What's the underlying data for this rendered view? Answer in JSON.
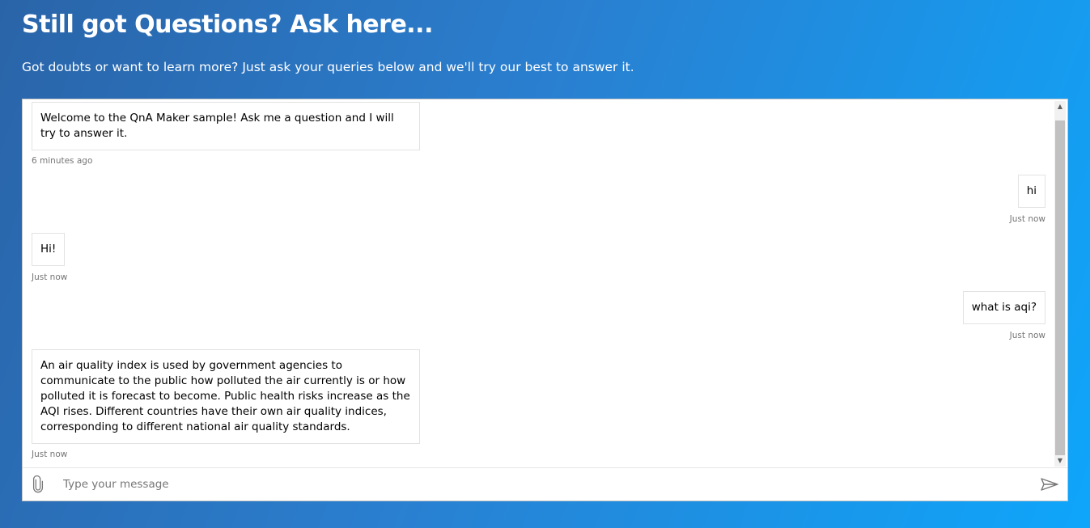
{
  "header": {
    "title": "Still got Questions? Ask here...",
    "subtitle": "Got doubts or want to learn more? Just ask your queries below and we'll try our best to answer it."
  },
  "chat": {
    "messages": [
      {
        "from": "bot",
        "text": "Welcome to the QnA Maker sample! Ask me a question and I will try to answer it.",
        "timestamp": "6 minutes ago"
      },
      {
        "from": "user",
        "text": "hi",
        "timestamp": "Just now"
      },
      {
        "from": "bot",
        "text": "Hi!",
        "timestamp": "Just now"
      },
      {
        "from": "user",
        "text": "what is aqi?",
        "timestamp": "Just now"
      },
      {
        "from": "bot",
        "text": "An air quality index is used by government agencies to communicate to the public how polluted the air currently is or how polluted it is forecast to become. Public health risks increase as the AQI rises. Different countries have their own air quality indices, corresponding to different national air quality standards.",
        "timestamp": "Just now"
      }
    ],
    "input": {
      "placeholder": "Type your message",
      "value": ""
    }
  },
  "icons": {
    "attach": "paperclip-icon",
    "send": "send-icon",
    "scroll_up": "scroll-up-arrow-icon",
    "scroll_down": "scroll-down-arrow-icon"
  }
}
